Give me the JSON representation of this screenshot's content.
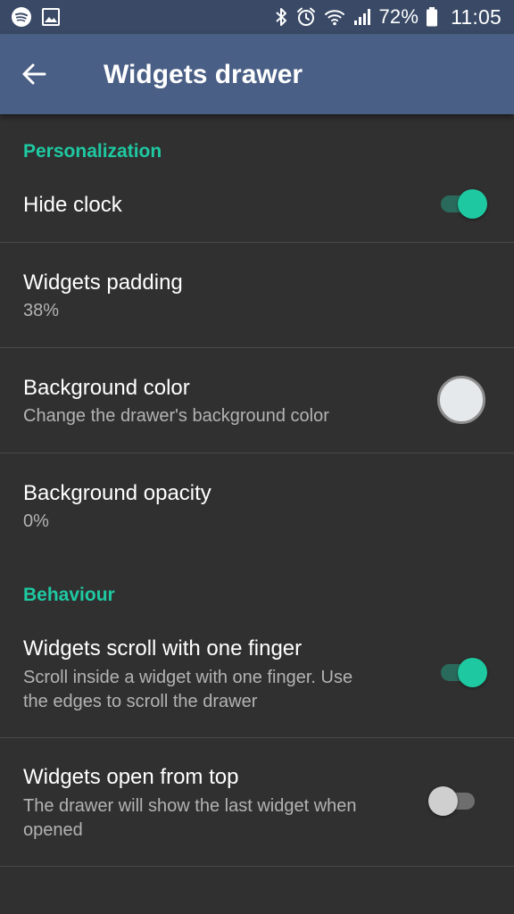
{
  "status_bar": {
    "left_icons": [
      "spotify-icon",
      "image-icon"
    ],
    "right_icons": [
      "bluetooth-icon",
      "alarm-icon",
      "wifi-icon",
      "signal-icon",
      "battery-icon"
    ],
    "battery": "72%",
    "time": "11:05"
  },
  "app_bar": {
    "back_icon": "arrow-back-icon",
    "title": "Widgets drawer"
  },
  "colors": {
    "accent": "#1ec9a2",
    "status_bar": "#3a4a66",
    "app_bar": "#4a5f85",
    "background": "#303030",
    "swatch": "#e6e9ec"
  },
  "sections": {
    "personalization": {
      "header": "Personalization",
      "hide_clock": {
        "title": "Hide clock",
        "enabled": true
      },
      "widgets_padding": {
        "title": "Widgets padding",
        "value": "38%"
      },
      "background_color": {
        "title": "Background color",
        "summary": "Change the drawer's background color"
      },
      "background_opacity": {
        "title": "Background opacity",
        "value": "0%"
      }
    },
    "behaviour": {
      "header": "Behaviour",
      "scroll_one_finger": {
        "title": "Widgets scroll with one finger",
        "summary": "Scroll inside a widget with one finger. Use the edges to scroll the drawer",
        "enabled": true
      },
      "open_from_top": {
        "title": "Widgets open from top",
        "summary": "The drawer will show the last widget when opened",
        "enabled": false
      }
    }
  }
}
